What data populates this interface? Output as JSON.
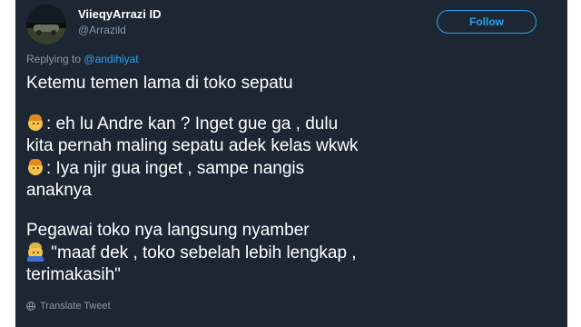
{
  "user": {
    "display_name": "ViieqyArrazi ID",
    "handle": "@Arrazild"
  },
  "follow_button": {
    "label": "Follow"
  },
  "reply": {
    "prefix": "Replying to",
    "mention": "@andihiyat"
  },
  "tweet": {
    "line1": "Ketemu temen lama di toko sepatu",
    "line2": ": eh lu Andre kan ? Inget gue ga , dulu",
    "line3": "kita pernah maling sepatu adek kelas wkwk",
    "line4": ": Iya njir gua inget , sampe nangis",
    "line5": "anaknya",
    "line6": "Pegawai toko nya langsung nyamber",
    "line7": "\"maaf dek , toko sebelah lebih lengkap ,",
    "line8": "terimakasih\""
  },
  "icons": {
    "avatar": "profile-photo",
    "emoji_person": "person-emoji",
    "emoji_worker": "construction-worker-emoji",
    "translate": "globe-icon"
  },
  "colors": {
    "background": "#1c2733",
    "accent": "#2aa1f2",
    "muted": "#8899a6",
    "text": "#ffffff"
  },
  "translate_link": "Translate Tweet"
}
